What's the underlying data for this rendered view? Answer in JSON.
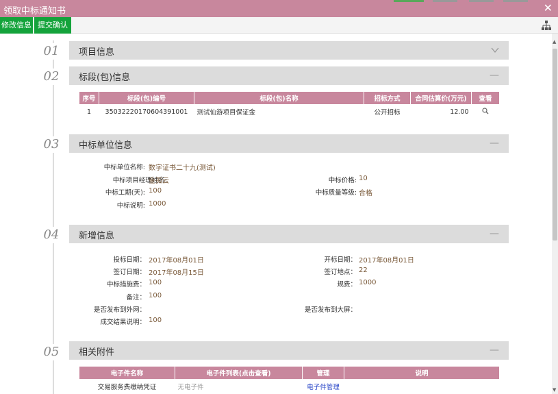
{
  "window": {
    "title": "领取中标通知书",
    "close_glyph": "✕"
  },
  "toolbar": {
    "edit_label": "修改信息",
    "submit_label": "提交确认",
    "sitemap_icon": "sitemap-icon"
  },
  "sections": [
    {
      "num": "01",
      "title": "项目信息",
      "toggle": "chevron-down"
    },
    {
      "num": "02",
      "title": "标段(包)信息",
      "toggle": "—"
    },
    {
      "num": "03",
      "title": "中标单位信息",
      "toggle": "—"
    },
    {
      "num": "04",
      "title": "新增信息",
      "toggle": "—"
    },
    {
      "num": "05",
      "title": "相关附件",
      "toggle": "—"
    }
  ],
  "lot_table": {
    "headers": [
      "序号",
      "标段(包)编号",
      "标段(包)名称",
      "招标方式",
      "合同估算价(万元)",
      "查看"
    ],
    "rows": [
      {
        "no": "1",
        "code": "35032220170604391001",
        "name": "测试仙游项目保证金",
        "method": "公开招标",
        "price": "12.00",
        "view_icon": "search-icon"
      }
    ]
  },
  "winner": {
    "unit_label": "中标单位名称:",
    "unit_value": "数字证书二十九(测试)",
    "manager_label": "中标项目经理姓名:",
    "manager_value": "金孤云",
    "price_label": "中标价格:",
    "price_value": "10",
    "period_label": "中标工期(天):",
    "period_value": "100",
    "quality_label": "中标质量等级:",
    "quality_value": "合格",
    "note_label": "中标说明:",
    "note_value": "1000"
  },
  "added": {
    "bid_date_label": "投标日期：",
    "bid_date_value": "2017年08月01日",
    "open_date_label": "开标日期：",
    "open_date_value": "2017年08月01日",
    "sign_date_label": "签订日期：",
    "sign_date_value": "2017年08月15日",
    "sign_place_label": "签订地点：",
    "sign_place_value": "22",
    "measure_fee_label": "中标措施费：",
    "measure_fee_value": "100",
    "regulation_fee_label": "规费：",
    "regulation_fee_value": "1000",
    "remark_label": "备注：",
    "remark_value": "100",
    "publish_web_label": "是否发布到外网：",
    "publish_screen_label": "是否发布到大屏：",
    "result_label": "成交结果说明：",
    "result_value": "100"
  },
  "attachments": {
    "headers": [
      "电子件名称",
      "电子件列表(点击查看)",
      "管理",
      "说明"
    ],
    "rows": [
      {
        "name": "交易服务费缴纳凭证",
        "files": "无电子件",
        "manage": "电子件管理",
        "desc": ""
      }
    ]
  },
  "colors": {
    "header_pink": "#c8879d",
    "button_green": "#14a33b",
    "section_gray": "#dcdcdc",
    "value_brown": "#7a5a3a",
    "link_blue": "#2a47c8"
  }
}
